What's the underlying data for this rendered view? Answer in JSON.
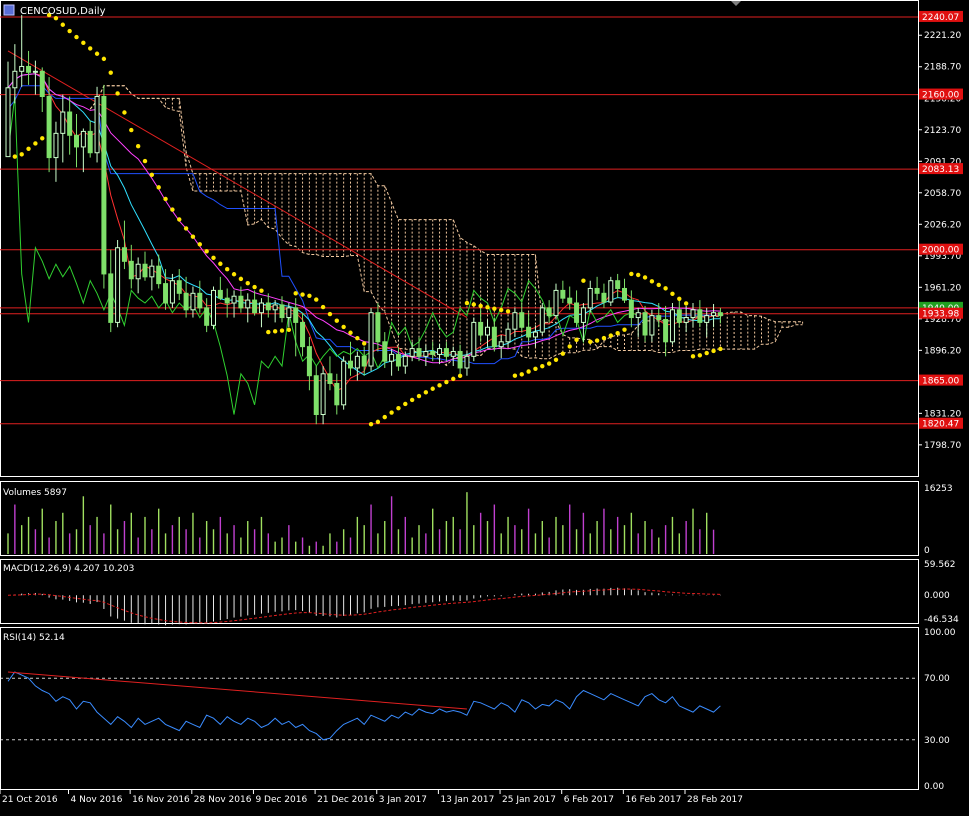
{
  "window": {
    "title": "CENCOSUD,Daily"
  },
  "colors": {
    "background": "#000000",
    "grid": "#ffffff",
    "bull": "#ccffcc",
    "bear": "#7fe06a",
    "hline": "#e02020",
    "sar": "#ffe600",
    "cloud": "#f2c9a0",
    "ma_fast": "#ff3030",
    "ma_mid": "#30e0ff",
    "ma_slow": "#ff40ff",
    "kijun": "#2050ff",
    "chikou": "#30d030",
    "volume_up": "#a0e060",
    "volume_down": "#c040d0",
    "rsi": "#3a8cff",
    "macd_signal": "#e02020",
    "tag_red": "#e01010",
    "tag_green": "#20a020"
  },
  "chart_data": [
    {
      "type": "candlestick",
      "title": "CENCOSUD,Daily",
      "ylim": [
        1766.57,
        2256.51
      ],
      "y_ticks": [
        "2221.20",
        "2188.70",
        "2156.20",
        "2123.70",
        "2091.20",
        "2058.70",
        "2026.20",
        "1993.70",
        "1961.20",
        "1928.70",
        "1896.20",
        "1863.70",
        "1831.20",
        "1798.70"
      ],
      "y_tick_values": [
        2221.2,
        2188.7,
        2156.2,
        2123.7,
        2091.2,
        2058.7,
        2026.2,
        1993.7,
        1961.2,
        1928.7,
        1896.2,
        1863.7,
        1831.2,
        1798.7
      ],
      "x_ticks": [
        "21 Oct 2016",
        "4 Nov 2016",
        "16 Nov 2016",
        "28 Nov 2016",
        "9 Dec 2016",
        "21 Dec 2016",
        "3 Jan 2017",
        "13 Jan 2017",
        "25 Jan 2017",
        "6 Feb 2017",
        "16 Feb 2017",
        "28 Feb 2017"
      ],
      "x_tick_index": [
        0,
        10,
        19,
        28,
        37,
        46,
        55,
        64,
        73,
        82,
        91,
        100
      ],
      "bars": 105,
      "levels": [
        {
          "label": "2240.07",
          "value": 2240.07
        },
        {
          "label": "2160.00",
          "value": 2160.0
        },
        {
          "label": "2083.13",
          "value": 2083.13
        },
        {
          "label": "2000.00",
          "value": 2000.0
        },
        {
          "label": "1940.00",
          "value": 1940.0
        },
        {
          "label": "1933.98",
          "value": 1933.98
        },
        {
          "label": "1865.00",
          "value": 1865.0
        },
        {
          "label": "1820.47",
          "value": 1820.47
        }
      ],
      "trendline": {
        "from": [
          0,
          2205
        ],
        "to": [
          67,
          1930
        ]
      },
      "ohlc": [
        [
          2096,
          2194,
          2096,
          2167
        ],
        [
          2167,
          2212,
          2151,
          2184
        ],
        [
          2184,
          2242,
          2168,
          2189
        ],
        [
          2189,
          2205,
          2170,
          2183
        ],
        [
          2183,
          2195,
          2160,
          2184
        ],
        [
          2184,
          2188,
          2142,
          2158
        ],
        [
          2158,
          2178,
          2080,
          2095
        ],
        [
          2095,
          2132,
          2070,
          2120
        ],
        [
          2120,
          2160,
          2090,
          2142
        ],
        [
          2142,
          2158,
          2098,
          2118
        ],
        [
          2118,
          2140,
          2085,
          2106
        ],
        [
          2106,
          2125,
          2080,
          2122
        ],
        [
          2122,
          2133,
          2095,
          2100
        ],
        [
          2100,
          2168,
          2090,
          2158
        ],
        [
          2158,
          2170,
          1960,
          1975
        ],
        [
          1975,
          2000,
          1915,
          1925
        ],
        [
          1925,
          2010,
          1920,
          2002
        ],
        [
          2002,
          2030,
          1980,
          1988
        ],
        [
          1988,
          2005,
          1960,
          1970
        ],
        [
          1970,
          1992,
          1955,
          1985
        ],
        [
          1985,
          1998,
          1968,
          1972
        ],
        [
          1972,
          1990,
          1958,
          1983
        ],
        [
          1983,
          1995,
          1960,
          1965
        ],
        [
          1965,
          1980,
          1938,
          1945
        ],
        [
          1945,
          1975,
          1940,
          1968
        ],
        [
          1968,
          1980,
          1948,
          1955
        ],
        [
          1955,
          1972,
          1930,
          1938
        ],
        [
          1938,
          1962,
          1930,
          1955
        ],
        [
          1955,
          1968,
          1935,
          1940
        ],
        [
          1940,
          1950,
          1915,
          1922
        ],
        [
          1922,
          1962,
          1918,
          1958
        ],
        [
          1958,
          1972,
          1948,
          1950
        ],
        [
          1950,
          1960,
          1930,
          1945
        ],
        [
          1945,
          1958,
          1930,
          1952
        ],
        [
          1952,
          1962,
          1935,
          1940
        ],
        [
          1940,
          1955,
          1925,
          1948
        ],
        [
          1948,
          1958,
          1932,
          1935
        ],
        [
          1935,
          1950,
          1920,
          1945
        ],
        [
          1945,
          1955,
          1930,
          1938
        ],
        [
          1938,
          1948,
          1925,
          1943
        ],
        [
          1943,
          1952,
          1925,
          1930
        ],
        [
          1930,
          1945,
          1920,
          1940
        ],
        [
          1940,
          1950,
          1890,
          1925
        ],
        [
          1925,
          1935,
          1890,
          1900
        ],
        [
          1900,
          1910,
          1855,
          1870
        ],
        [
          1870,
          1880,
          1820,
          1830
        ],
        [
          1830,
          1880,
          1820,
          1872
        ],
        [
          1872,
          1890,
          1855,
          1862
        ],
        [
          1862,
          1872,
          1830,
          1840
        ],
        [
          1840,
          1890,
          1835,
          1885
        ],
        [
          1885,
          1905,
          1870,
          1878
        ],
        [
          1878,
          1895,
          1865,
          1890
        ],
        [
          1890,
          1900,
          1870,
          1880
        ],
        [
          1880,
          1940,
          1875,
          1935
        ],
        [
          1935,
          1945,
          1895,
          1905
        ],
        [
          1905,
          1915,
          1878,
          1885
        ],
        [
          1885,
          1898,
          1870,
          1892
        ],
        [
          1892,
          1900,
          1875,
          1880
        ],
        [
          1880,
          1895,
          1872,
          1890
        ],
        [
          1890,
          1905,
          1885,
          1898
        ],
        [
          1898,
          1910,
          1885,
          1890
        ],
        [
          1890,
          1902,
          1880,
          1895
        ],
        [
          1895,
          1905,
          1885,
          1892
        ],
        [
          1892,
          1903,
          1882,
          1898
        ],
        [
          1898,
          1905,
          1885,
          1890
        ],
        [
          1890,
          1900,
          1880,
          1895
        ],
        [
          1895,
          1902,
          1870,
          1878
        ],
        [
          1878,
          1895,
          1870,
          1890
        ],
        [
          1890,
          1930,
          1885,
          1925
        ],
        [
          1925,
          1940,
          1905,
          1912
        ],
        [
          1912,
          1928,
          1900,
          1920
        ],
        [
          1920,
          1930,
          1895,
          1900
        ],
        [
          1900,
          1912,
          1888,
          1905
        ],
        [
          1905,
          1925,
          1900,
          1918
        ],
        [
          1918,
          1940,
          1910,
          1935
        ],
        [
          1935,
          1945,
          1915,
          1920
        ],
        [
          1920,
          1935,
          1905,
          1910
        ],
        [
          1910,
          1922,
          1900,
          1915
        ],
        [
          1915,
          1945,
          1912,
          1940
        ],
        [
          1940,
          1948,
          1925,
          1932
        ],
        [
          1932,
          1965,
          1928,
          1958
        ],
        [
          1958,
          1968,
          1945,
          1950
        ],
        [
          1950,
          1962,
          1938,
          1945
        ],
        [
          1945,
          1958,
          1920,
          1925
        ],
        [
          1925,
          1945,
          1905,
          1940
        ],
        [
          1940,
          1968,
          1935,
          1960
        ],
        [
          1960,
          1972,
          1948,
          1955
        ],
        [
          1955,
          1965,
          1940,
          1946
        ],
        [
          1946,
          1972,
          1942,
          1968
        ],
        [
          1968,
          1975,
          1950,
          1960
        ],
        [
          1960,
          1970,
          1945,
          1948
        ],
        [
          1948,
          1958,
          1920,
          1930
        ],
        [
          1930,
          1940,
          1910,
          1935
        ],
        [
          1935,
          1942,
          1905,
          1912
        ],
        [
          1912,
          1938,
          1905,
          1932
        ],
        [
          1932,
          1945,
          1920,
          1928
        ],
        [
          1928,
          1942,
          1890,
          1905
        ],
        [
          1905,
          1945,
          1902,
          1938
        ],
        [
          1938,
          1948,
          1920,
          1925
        ],
        [
          1925,
          1942,
          1915,
          1930
        ],
        [
          1930,
          1945,
          1920,
          1938
        ],
        [
          1938,
          1948,
          1920,
          1925
        ],
        [
          1925,
          1940,
          1910,
          1932
        ],
        [
          1932,
          1944,
          1920,
          1935
        ],
        [
          1935,
          1940,
          1924,
          1932
        ]
      ]
    },
    {
      "type": "bar",
      "title": "Volumes",
      "value": "5897",
      "ylim": [
        0,
        16253
      ],
      "y_ticks": [
        "16253",
        "0"
      ],
      "values": [
        5000,
        12000,
        7000,
        9000,
        6000,
        11000,
        4000,
        8000,
        10000,
        5000,
        6000,
        14000,
        7000,
        9000,
        5000,
        12000,
        6000,
        8000,
        10000,
        4000,
        9000,
        6000,
        11000,
        5000,
        7000,
        9000,
        6000,
        10000,
        4000,
        8000,
        6000,
        9000,
        5000,
        7000,
        4000,
        8000,
        6000,
        9000,
        5000,
        3000,
        4000,
        7000,
        3000,
        4000,
        2000,
        3000,
        2000,
        5000,
        3000,
        6000,
        4000,
        9000,
        7000,
        12000,
        5000,
        8000,
        14000,
        6000,
        9000,
        4000,
        7000,
        5000,
        11000,
        6000,
        8000,
        9000,
        6000,
        15000,
        7000,
        10000,
        8000,
        12000,
        5000,
        9000,
        7000,
        6000,
        11000,
        5000,
        8000,
        4000,
        9000,
        7000,
        12000,
        6000,
        10000,
        5000,
        8000,
        11000,
        6000,
        9000,
        7000,
        10000,
        5000,
        8000,
        6000,
        4000,
        7000,
        9000,
        5000,
        8000,
        11000,
        6000,
        10000,
        5897,
        0
      ],
      "up": [
        1,
        0,
        1,
        1,
        0,
        1,
        0,
        1,
        1,
        0,
        1,
        1,
        0,
        1,
        0,
        1,
        1,
        0,
        1,
        0,
        1,
        0,
        1,
        1,
        0,
        1,
        0,
        1,
        0,
        1,
        1,
        0,
        1,
        0,
        1,
        1,
        0,
        1,
        0,
        1,
        1,
        0,
        1,
        0,
        1,
        0,
        1,
        1,
        0,
        1,
        0,
        1,
        1,
        0,
        1,
        1,
        0,
        1,
        0,
        1,
        1,
        0,
        1,
        0,
        1,
        1,
        0,
        1,
        1,
        0,
        1,
        0,
        1,
        1,
        0,
        1,
        0,
        1,
        1,
        0,
        1,
        1,
        0,
        1,
        0,
        1,
        1,
        0,
        1,
        0,
        1,
        1,
        0,
        1,
        0,
        1,
        0,
        1,
        1,
        0,
        1,
        0,
        1,
        0,
        0
      ]
    },
    {
      "type": "bar",
      "title": "MACD(12,26,9)",
      "values_text": "4.207 10.203",
      "ylim": [
        -46.534,
        59.562
      ],
      "y_ticks": [
        "59.562",
        "0.000",
        "-46.534"
      ]
    },
    {
      "type": "line",
      "title": "RSI(14)",
      "value": "52.14",
      "ylim": [
        0,
        100
      ],
      "y_ticks": [
        "100.00",
        "70.00",
        "30.00",
        "0.00"
      ],
      "levels": [
        70,
        30
      ],
      "trendline": {
        "from": [
          0,
          74
        ],
        "to": [
          67,
          50
        ]
      },
      "values": [
        68,
        74,
        72,
        70,
        65,
        62,
        60,
        55,
        58,
        56,
        50,
        55,
        54,
        48,
        44,
        40,
        45,
        42,
        38,
        44,
        40,
        42,
        44,
        40,
        38,
        36,
        42,
        40,
        38,
        46,
        44,
        40,
        45,
        42,
        40,
        44,
        42,
        38,
        40,
        44,
        40,
        42,
        38,
        40,
        36,
        34,
        30,
        31,
        36,
        40,
        42,
        44,
        40,
        46,
        44,
        42,
        46,
        44,
        48,
        46,
        50,
        48,
        47,
        50,
        48,
        49,
        48,
        46,
        55,
        54,
        52,
        50,
        54,
        52,
        48,
        56,
        54,
        50,
        53,
        52,
        56,
        54,
        50,
        58,
        62,
        60,
        58,
        56,
        60,
        58,
        56,
        54,
        52,
        58,
        60,
        56,
        54,
        58,
        52,
        50,
        48,
        52,
        50,
        48,
        52
      ]
    }
  ]
}
